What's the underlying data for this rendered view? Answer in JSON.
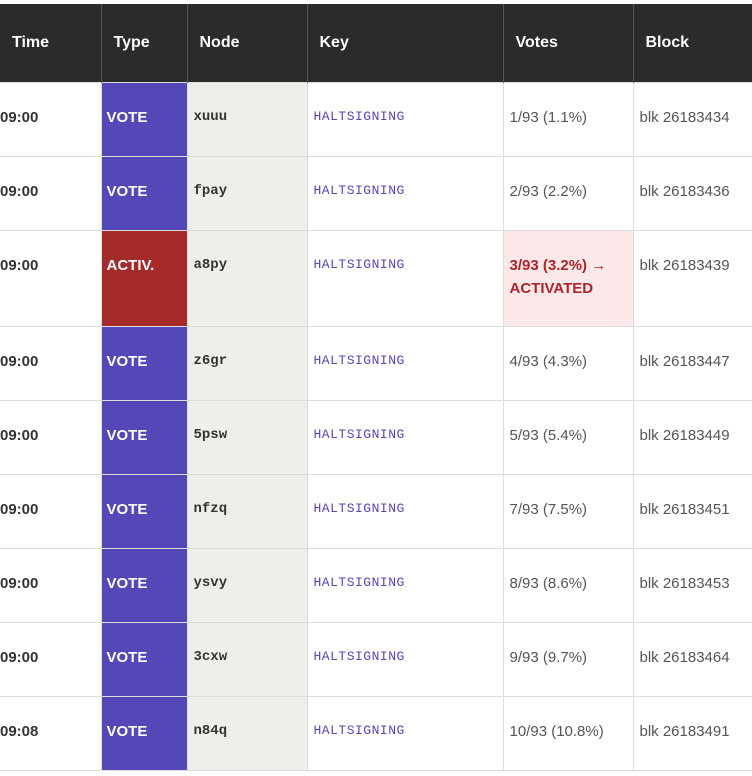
{
  "headers": [
    "Time",
    "Type",
    "Node",
    "Key",
    "Votes",
    "Block"
  ],
  "colors": {
    "header_bg": "#2b2b2b",
    "vote": "#5448b8",
    "activated": "#a52a2a",
    "highlight_bg": "#fbe8e8",
    "highlight_text": "#b0232a"
  },
  "rows": [
    {
      "time": "09:00",
      "type": "VOTE",
      "node": "xuuu",
      "key": "HALTSIGNING",
      "votes": "1/93 (1.1%)",
      "block": "blk 26183434"
    },
    {
      "time": "09:00",
      "type": "VOTE",
      "node": "fpay",
      "key": "HALTSIGNING",
      "votes": "2/93 (2.2%)",
      "block": "blk 26183436"
    },
    {
      "time": "09:00",
      "type": "ACTIV.",
      "node": "a8py",
      "key": "HALTSIGNING",
      "votes": "3/93 (3.2%) → ACTIVATED",
      "block": "blk 26183439"
    },
    {
      "time": "09:00",
      "type": "VOTE",
      "node": "z6gr",
      "key": "HALTSIGNING",
      "votes": "4/93 (4.3%)",
      "block": "blk 26183447"
    },
    {
      "time": "09:00",
      "type": "VOTE",
      "node": "5psw",
      "key": "HALTSIGNING",
      "votes": "5/93 (5.4%)",
      "block": "blk 26183449"
    },
    {
      "time": "09:00",
      "type": "VOTE",
      "node": "nfzq",
      "key": "HALTSIGNING",
      "votes": "7/93 (7.5%)",
      "block": "blk 26183451"
    },
    {
      "time": "09:00",
      "type": "VOTE",
      "node": "ysvy",
      "key": "HALTSIGNING",
      "votes": "8/93 (8.6%)",
      "block": "blk 26183453"
    },
    {
      "time": "09:00",
      "type": "VOTE",
      "node": "3cxw",
      "key": "HALTSIGNING",
      "votes": "9/93 (9.7%)",
      "block": "blk 26183464"
    },
    {
      "time": "09:08",
      "type": "VOTE",
      "node": "n84q",
      "key": "HALTSIGNING",
      "votes": "10/93 (10.8%)",
      "block": "blk 26183491"
    }
  ]
}
